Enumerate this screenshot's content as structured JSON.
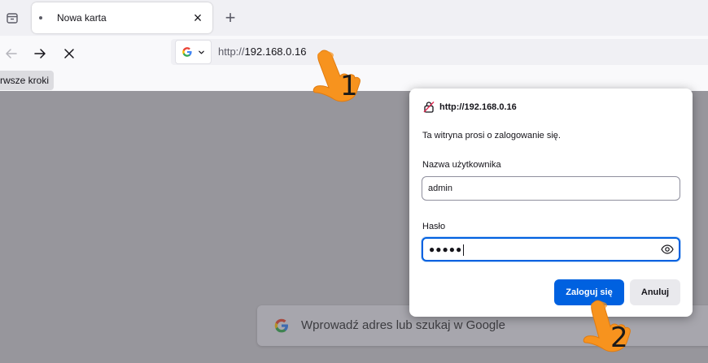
{
  "tabs": [
    {
      "title": "Nowa karta",
      "close": "×"
    }
  ],
  "new_tab_label": "+",
  "urlbar": {
    "scheme": "http://",
    "host": "192.168.0.16"
  },
  "bookmarks": [
    {
      "label": "rwsze kroki"
    }
  ],
  "search": {
    "placeholder": "Wprowadź adres lub szukaj w Google"
  },
  "auth_dialog": {
    "site": "http://192.168.0.16",
    "message": "Ta witryna prosi o zalogowanie się.",
    "username_label": "Nazwa użytkownika",
    "username_value": "admin",
    "password_label": "Hasło",
    "password_value": "●●●●●",
    "login_button": "Zaloguj się",
    "cancel_button": "Anuluj"
  },
  "annotations": {
    "step1": "1",
    "step2": "2"
  },
  "colors": {
    "accent": "#0061e0",
    "annotation_hand": "#f7931e",
    "overlay": "#97969c"
  }
}
